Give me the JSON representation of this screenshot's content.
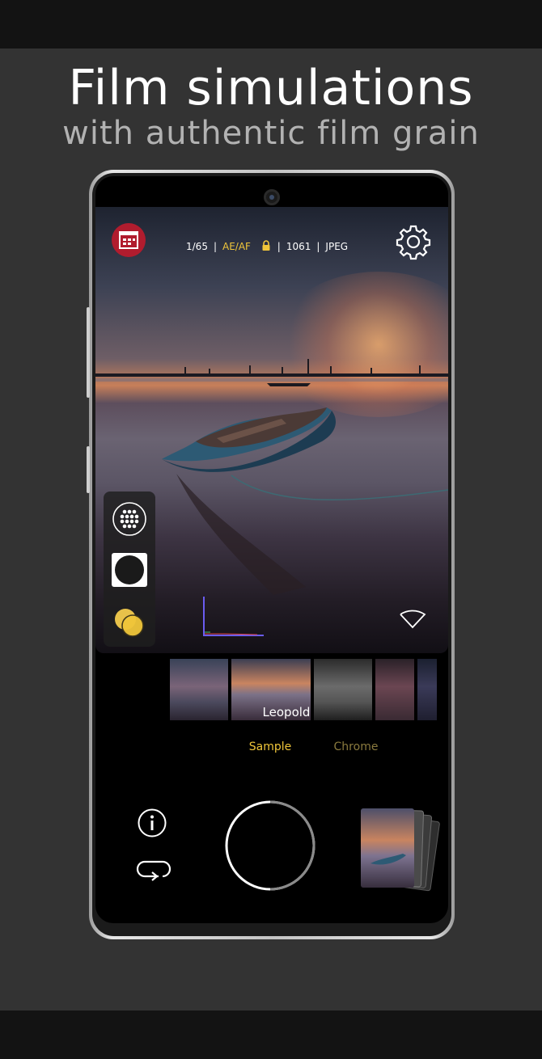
{
  "promo": {
    "headline": "Film simulations",
    "subheadline": "with authentic film grain"
  },
  "camera_app": {
    "status": {
      "shutter_speed": "1/65",
      "exposure_mode": "AE/AF",
      "lock_icon": "lock-icon",
      "shots_remaining": "1061",
      "format": "JPEG",
      "accent_color": "#f0c63a"
    },
    "film_strip": {
      "selected_label": "Leopold"
    },
    "modes": {
      "sample": "Sample",
      "chrome": "Chrome"
    },
    "icons": {
      "menu": "film-menu-icon",
      "settings": "gear-icon",
      "grid": "grid-dots-icon",
      "circle": "circle-icon",
      "filter": "color-filter-icon",
      "collapse": "chevron-down-icon",
      "info": "info-icon",
      "loop": "loop-icon",
      "shutter": "shutter-button",
      "gallery": "gallery-stack-icon"
    },
    "brand_color": "#b01c2e"
  }
}
